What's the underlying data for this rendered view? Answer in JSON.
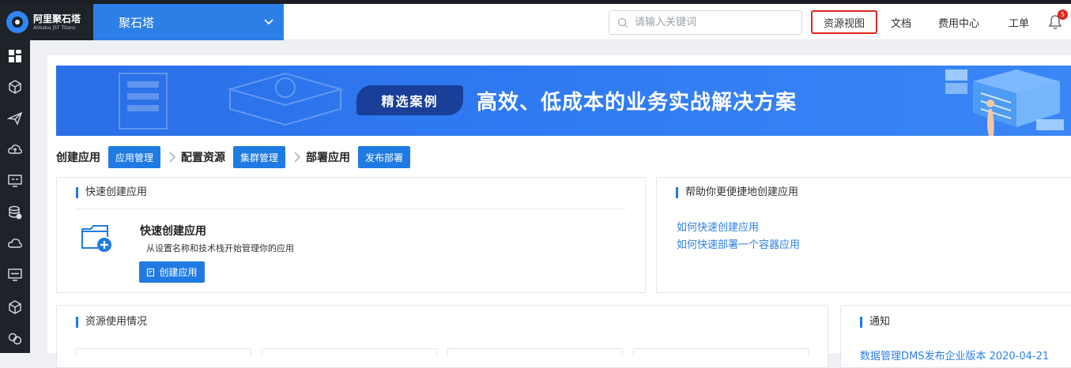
{
  "header": {
    "logo_cn": "阿里聚石塔",
    "logo_en": "Alibaba JST Titans",
    "product_selector": "聚石塔",
    "search_placeholder": "请输入关键词",
    "nav": {
      "resource_view": "资源视图",
      "docs": "文档",
      "billing": "费用中心",
      "tickets": "工单"
    },
    "notification_count": "5"
  },
  "sidebar": {
    "icons": [
      "dashboard-icon",
      "cube-icon",
      "send-icon",
      "cloud-upload-icon",
      "server-icon",
      "database-icon",
      "cloud-icon",
      "monitor-icon",
      "box-icon",
      "link-icon"
    ]
  },
  "banner": {
    "tag": "精选案例",
    "title": "高效、低成本的业务实战解决方案"
  },
  "steps": [
    {
      "label": "创建应用",
      "button": "应用管理"
    },
    {
      "label": "配置资源",
      "button": "集群管理"
    },
    {
      "label": "部署应用",
      "button": "发布部署"
    }
  ],
  "quick_create": {
    "title": "快速创建应用",
    "heading": "快速创建应用",
    "description": "从设置名称和技术栈开始管理你的应用",
    "button": "创建应用"
  },
  "help": {
    "title": "帮助你更便捷地创建应用",
    "links": [
      "如何快速创建应用",
      "如何快速部署一个容器应用"
    ]
  },
  "resources": {
    "title": "资源使用情况"
  },
  "notice": {
    "title": "通知",
    "first_item": "数据管理DMS发布企业版本 2020-04-21"
  },
  "colors": {
    "primary": "#1f7be3",
    "sidebar": "#1e2329",
    "highlight_border": "#e0261b"
  }
}
